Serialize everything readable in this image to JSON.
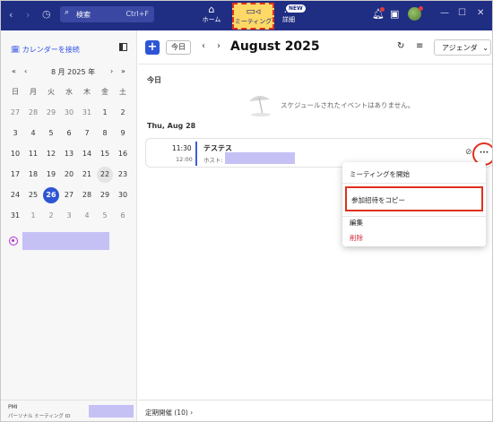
{
  "titlebar": {
    "search_label": "検索",
    "search_shortcut": "Ctrl+F",
    "nav_home": "ホーム",
    "nav_meeting": "ミーティング",
    "nav_more": "詳細",
    "new_badge": "NEW"
  },
  "sidebar": {
    "connect_calendar": "カレンダーを接続",
    "mini_month": "8 月 2025 年",
    "weekdays": [
      "日",
      "月",
      "火",
      "水",
      "木",
      "金",
      "土"
    ],
    "weeks": [
      [
        "27",
        "28",
        "29",
        "30",
        "31",
        "1",
        "2"
      ],
      [
        "3",
        "4",
        "5",
        "6",
        "7",
        "8",
        "9"
      ],
      [
        "10",
        "11",
        "12",
        "13",
        "14",
        "15",
        "16"
      ],
      [
        "17",
        "18",
        "19",
        "20",
        "21",
        "22",
        "23"
      ],
      [
        "24",
        "25",
        "26",
        "27",
        "28",
        "29",
        "30"
      ],
      [
        "31",
        "1",
        "2",
        "3",
        "4",
        "5",
        "6"
      ]
    ],
    "today_day": "26",
    "selected_day": "22",
    "footer_label": "PMI",
    "footer_sub": "パーソナル ミーティング ID"
  },
  "main": {
    "today_button": "今日",
    "month_title": "August 2025",
    "view_select": "アジェンダ",
    "today_heading": "今日",
    "empty_message": "スケジュールされたイベントはありません。",
    "date_heading": "Thu, Aug 28",
    "event": {
      "start": "11:30",
      "end": "12:00",
      "title": "テステス",
      "host_prefix": "ホスト:"
    },
    "context_menu": {
      "start_meeting": "ミーティングを開始",
      "copy_invite": "参加招待をコピー",
      "edit": "編集",
      "delete": "削除"
    },
    "recurring_link": "定期開催 (10)"
  },
  "colors": {
    "titlebar": "#1f2d83",
    "accent": "#2e55d4",
    "highlight_red": "#e0301e",
    "redacted": "#c5c1f5",
    "delete_red": "#d42c3c"
  }
}
